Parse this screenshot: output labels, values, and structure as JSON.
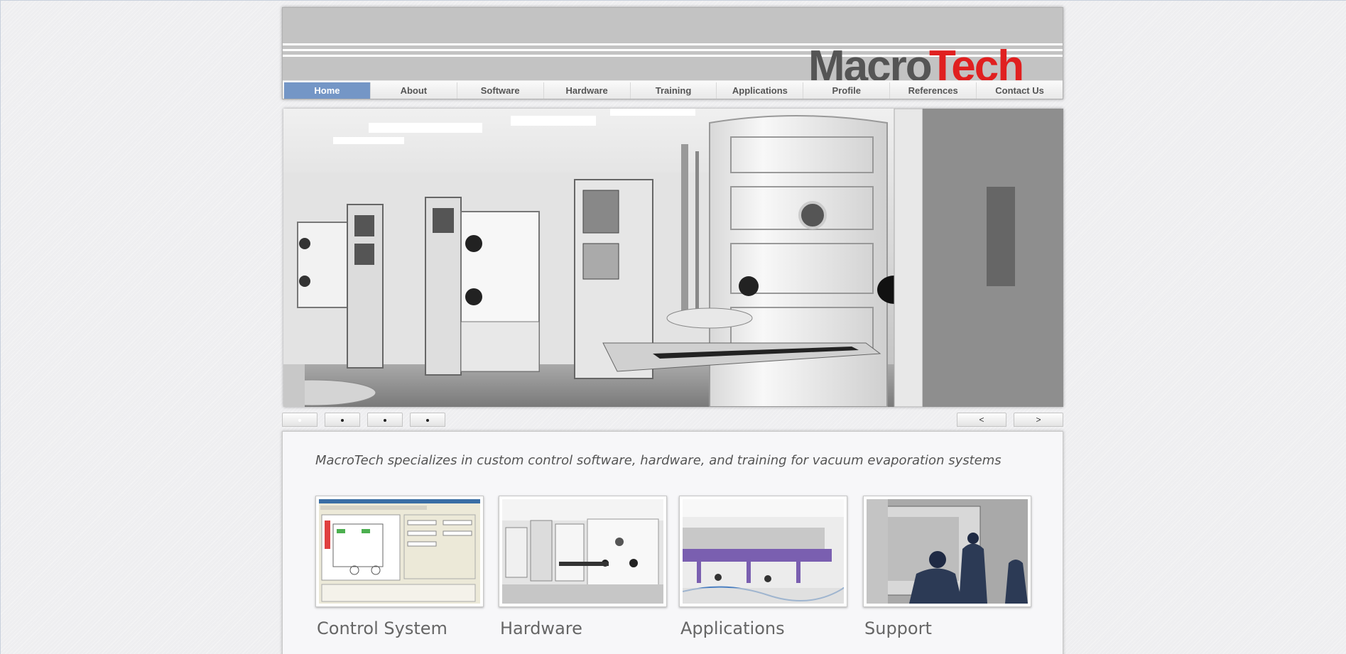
{
  "brand": {
    "logo_text_a": "Macro",
    "logo_text_b": "Tech",
    "logo_gray": "#555555",
    "logo_red": "#e02020"
  },
  "nav": {
    "items": [
      {
        "label": "Home",
        "active": true
      },
      {
        "label": "About"
      },
      {
        "label": "Software"
      },
      {
        "label": "Hardware"
      },
      {
        "label": "Training"
      },
      {
        "label": "Applications"
      },
      {
        "label": "Profile"
      },
      {
        "label": "References"
      },
      {
        "label": "Contact Us"
      }
    ],
    "active_color": "#7496c6"
  },
  "slider": {
    "slide_count": 4,
    "current_slide": 1,
    "prev_label": "<",
    "next_label": ">"
  },
  "content": {
    "tagline": "MacroTech specializes in custom control software, hardware, and training for vacuum evaporation systems",
    "cards": [
      {
        "title": "Control System",
        "image": "control-software-screenshot"
      },
      {
        "title": "Hardware",
        "image": "evaporation-chamber-photo"
      },
      {
        "title": "Applications",
        "image": "production-line-photo"
      },
      {
        "title": "Support",
        "image": "technicians-photo"
      }
    ]
  }
}
